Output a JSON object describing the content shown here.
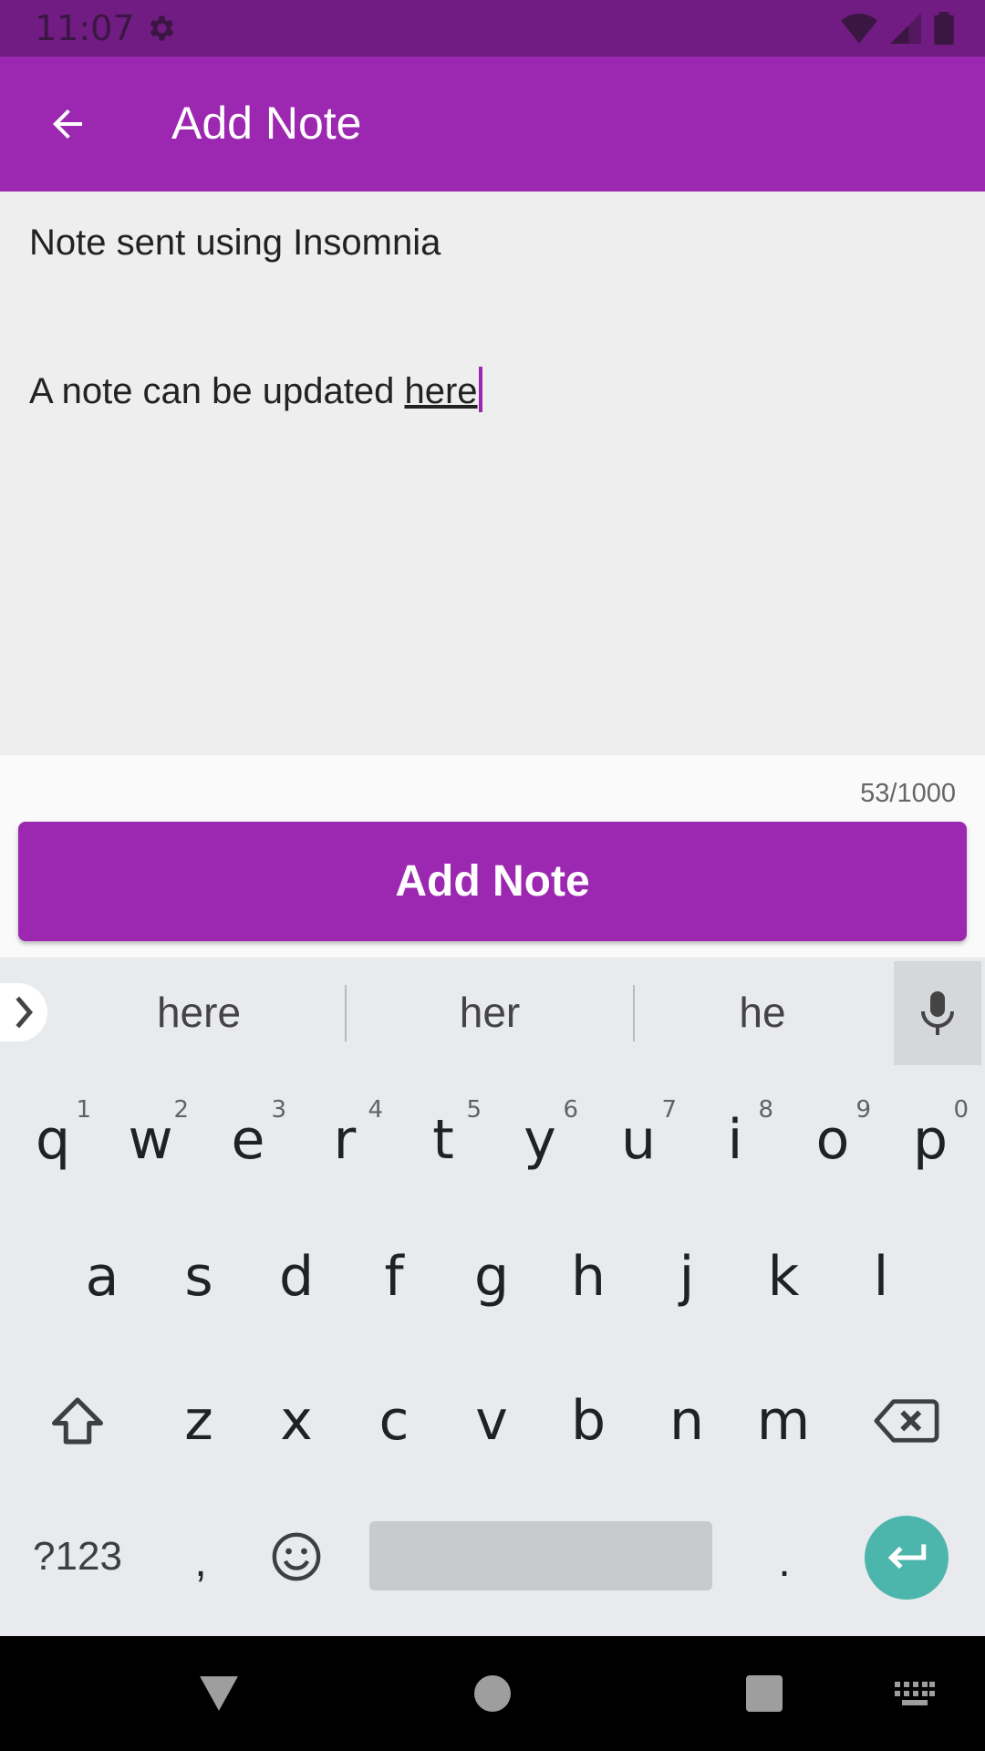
{
  "status_bar": {
    "time": "11:07",
    "icons": [
      "gear-icon",
      "wifi-icon",
      "signal-icon",
      "battery-icon"
    ]
  },
  "app_bar": {
    "title": "Add Note",
    "back_icon": "arrow-back-icon"
  },
  "note": {
    "line1": "Note sent using Insomnia",
    "line2_prefix": "A note can be updated ",
    "line2_underlined": "here",
    "char_count": "53/1000"
  },
  "add_button": {
    "label": "Add Note"
  },
  "keyboard": {
    "suggestions": [
      "here",
      "her",
      "he"
    ],
    "row1": [
      {
        "key": "q",
        "hint": "1"
      },
      {
        "key": "w",
        "hint": "2"
      },
      {
        "key": "e",
        "hint": "3"
      },
      {
        "key": "r",
        "hint": "4"
      },
      {
        "key": "t",
        "hint": "5"
      },
      {
        "key": "y",
        "hint": "6"
      },
      {
        "key": "u",
        "hint": "7"
      },
      {
        "key": "i",
        "hint": "8"
      },
      {
        "key": "o",
        "hint": "9"
      },
      {
        "key": "p",
        "hint": "0"
      }
    ],
    "row2": [
      "a",
      "s",
      "d",
      "f",
      "g",
      "h",
      "j",
      "k",
      "l"
    ],
    "row3": [
      "z",
      "x",
      "c",
      "v",
      "b",
      "n",
      "m"
    ],
    "symbols_label": "?123",
    "comma": ",",
    "period": "."
  },
  "colors": {
    "primary": "#9c27b0",
    "status_bar": "#711c83",
    "enter": "#4db6ac"
  }
}
